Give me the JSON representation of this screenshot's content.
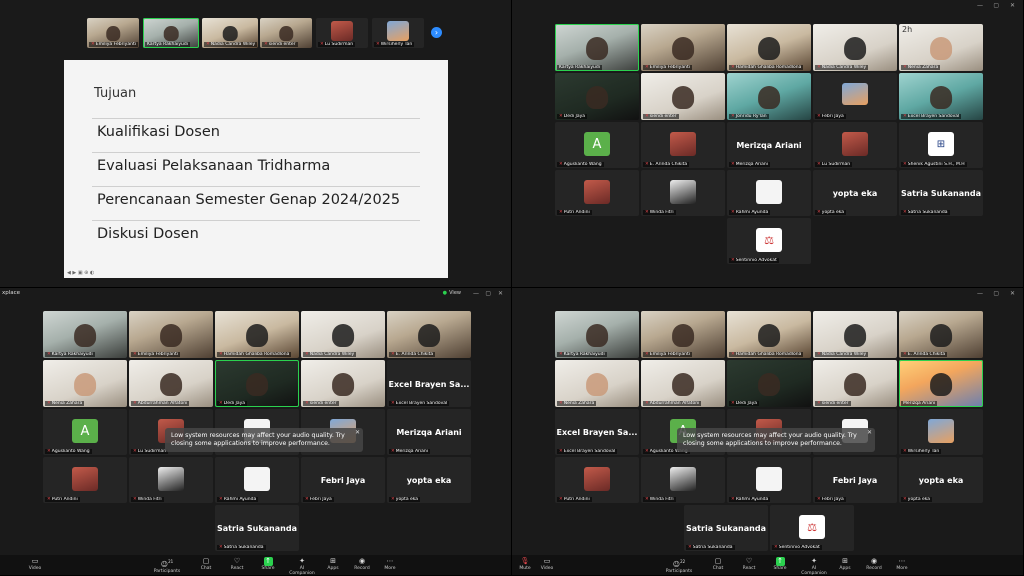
{
  "q1": {
    "strip": [
      {
        "name": "Emiliya Febriyanti"
      },
      {
        "name": "Kartya Rakhaiyudi",
        "active": true
      },
      {
        "name": "Nadia Candra Wiley"
      },
      {
        "name": "siendi enter"
      },
      {
        "name": "Lu Sudirman"
      },
      {
        "name": "Wirsiherly Tan"
      }
    ],
    "slide": {
      "title": "Tujuan",
      "items": [
        "Kualifikasi Dosen",
        "Evaluasi Pelaksanaan Tridharma",
        "Perencanaan Semester Genap 2024/2025",
        "Diskusi Dosen"
      ]
    },
    "strip_arrow": "›"
  },
  "q2": {
    "window_controls": {
      "minimize": "—",
      "maximize": "▢",
      "close": "✕"
    },
    "tiles": [
      {
        "name": "Kartya Rakhaiyudi"
      },
      {
        "name": "Emiliya Febriyanti"
      },
      {
        "name": "Hamidah Ghaliba Romadlona"
      },
      {
        "name": "Nadia Candra Wiley"
      },
      {
        "name": "Nenia Zahara"
      },
      {
        "name": "Dedi Jaya"
      },
      {
        "name": "siendi enter"
      },
      {
        "name": "Jonridu Ry'lan"
      },
      {
        "name": "Febri Jaya"
      },
      {
        "name": "Excel Brayen Sandoval"
      },
      {
        "name": "Aguslianto Wang",
        "avatar": "A"
      },
      {
        "name": "E. Arinda Chikita"
      },
      {
        "name": "Merizqa Ariani",
        "big": "Merizqa Ariani"
      },
      {
        "name": "Lu Sudirman"
      },
      {
        "name": "Shenik Agustini S.H., M.H"
      },
      {
        "name": "Putri Andini"
      },
      {
        "name": "Winda Fitri"
      },
      {
        "name": "Rahmi Ayunda"
      },
      {
        "name": "yopta eka",
        "big": "yopta eka"
      },
      {
        "name": "Satria Sukananda",
        "big": "Satria Sukananda"
      },
      {
        "name": "Sentinnio Advokat"
      }
    ],
    "mini_logo": "2h"
  },
  "q3": {
    "title": "xplace",
    "view_label": "View",
    "window_controls": {
      "minimize": "—",
      "maximize": "▢",
      "close": "✕"
    },
    "shield": "●",
    "tiles": [
      {
        "name": "Kartya Rakhaiyudi"
      },
      {
        "name": "Emiliya Febriyanti"
      },
      {
        "name": "Hamidah Ghaliba Romadlona"
      },
      {
        "name": "Nadia Candra Wiley"
      },
      {
        "name": "E. Arinda Chikita"
      },
      {
        "name": "Nenia Zahara"
      },
      {
        "name": "Abdurrahman Alfatoni"
      },
      {
        "name": "Dedi Jaya"
      },
      {
        "name": "siendi enter"
      },
      {
        "name": "Excel Brayen Sandoval",
        "big": "Excel Brayen Sa..."
      },
      {
        "name": "Aguslianto Wang",
        "avatar": "A"
      },
      {
        "name": "Lu Sudirman"
      },
      {
        "name": ""
      },
      {
        "name": ""
      },
      {
        "name": "Merizqa Ariani",
        "big": "Merizqa Ariani"
      },
      {
        "name": "Putri Andini"
      },
      {
        "name": "Winda Fitri"
      },
      {
        "name": "Rahmi Ayunda"
      },
      {
        "name": "Febri Jaya",
        "big": "Febri Jaya"
      },
      {
        "name": "yopta eka",
        "big": "yopta eka"
      },
      {
        "name": "Satria Sukananda",
        "big": "Satria Sukananda"
      }
    ],
    "toast": {
      "line1": "Low system resources may affect your audio quality. Try",
      "line2": "closing some applications to improve performance.",
      "close": "✕"
    },
    "toolbar": [
      {
        "label": "Video",
        "icon": "▭"
      },
      {
        "label": "Participants",
        "icon": "☺",
        "count": "21"
      },
      {
        "label": "Chat",
        "icon": "▢"
      },
      {
        "label": "React",
        "icon": "♡"
      },
      {
        "label": "Share",
        "icon": "↑"
      },
      {
        "label": "AI Companion",
        "icon": "✦"
      },
      {
        "label": "Apps",
        "icon": "⊞"
      },
      {
        "label": "Record",
        "icon": "◉"
      },
      {
        "label": "More",
        "icon": "⋯"
      }
    ]
  },
  "q4": {
    "window_controls": {
      "minimize": "—",
      "maximize": "▢",
      "close": "✕"
    },
    "tiles": [
      {
        "name": "Kartya Rakhaiyudi"
      },
      {
        "name": "Emiliya Febriyanti"
      },
      {
        "name": "Hamidah Ghaliba Romadlona"
      },
      {
        "name": "Nadia Candra Wiley"
      },
      {
        "name": "E. Arinda Chikita"
      },
      {
        "name": "Nenia Zahara"
      },
      {
        "name": "Abdurrahman Alfatoni"
      },
      {
        "name": "Dedi Jaya"
      },
      {
        "name": "siendi enter"
      },
      {
        "name": "Merizqa Ariani"
      },
      {
        "name": "Excel Brayen Sandoval",
        "big": "Excel Brayen Sa..."
      },
      {
        "name": "Aguslianto Wang",
        "avatar": "A"
      },
      {
        "name": ""
      },
      {
        "name": ""
      },
      {
        "name": "Wirsiherly Tan"
      },
      {
        "name": "Putri Andini"
      },
      {
        "name": "Winda Fitri"
      },
      {
        "name": "Rahmi Ayunda"
      },
      {
        "name": "Febri Jaya",
        "big": "Febri Jaya"
      },
      {
        "name": "yopta eka",
        "big": "yopta eka"
      },
      {
        "name": "Satria Sukananda",
        "big": "Satria Sukananda"
      },
      {
        "name": "Sentinnio Advokat"
      }
    ],
    "toast": {
      "line1": "Low system resources may affect your audio quality. Try",
      "line2": "closing some applications to improve performance.",
      "close": "✕"
    },
    "toolbar": [
      {
        "label": "Mute",
        "icon": "🎙"
      },
      {
        "label": "Video",
        "icon": "▭"
      },
      {
        "label": "Participants",
        "icon": "☺",
        "count": "22"
      },
      {
        "label": "Chat",
        "icon": "▢"
      },
      {
        "label": "React",
        "icon": "♡"
      },
      {
        "label": "Share",
        "icon": "↑"
      },
      {
        "label": "AI Companion",
        "icon": "✦"
      },
      {
        "label": "Apps",
        "icon": "⊞"
      },
      {
        "label": "Record",
        "icon": "◉"
      },
      {
        "label": "More",
        "icon": "⋯"
      }
    ]
  },
  "colors": {
    "active_border": "#2bd14f",
    "accent_blue": "#2d8cff",
    "muted_mic": "#e5484d",
    "avatar_green": "#5bb04a"
  }
}
